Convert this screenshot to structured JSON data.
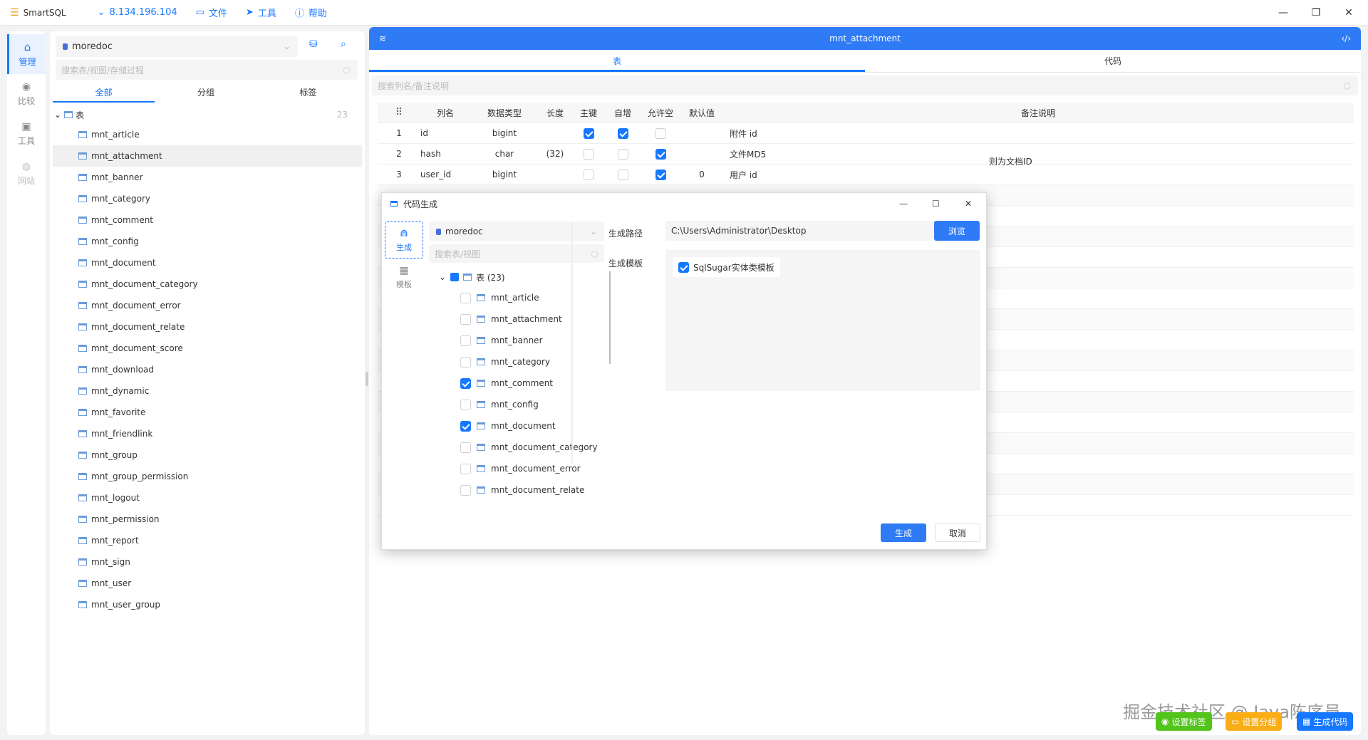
{
  "app": {
    "name": "SmartSQL",
    "server": "8.134.196.104",
    "menu": [
      {
        "label": "文件",
        "icon": "folder-icon"
      },
      {
        "label": "工具",
        "icon": "send-icon"
      },
      {
        "label": "帮助",
        "icon": "info-icon"
      }
    ]
  },
  "nav": [
    {
      "label": "管理",
      "icon": "home-icon",
      "active": true
    },
    {
      "label": "比较",
      "icon": "compare-icon",
      "active": false
    },
    {
      "label": "工具",
      "icon": "tools-icon",
      "active": false
    },
    {
      "label": "网站",
      "icon": "globe-icon",
      "active": false
    }
  ],
  "left": {
    "database": "moredoc",
    "search_placeholder": "搜索表/视图/存储过程",
    "tabs": [
      "全部",
      "分组",
      "标签"
    ],
    "tree_root": "表",
    "tree_count": "23",
    "tables": [
      "mnt_article",
      "mnt_attachment",
      "mnt_banner",
      "mnt_category",
      "mnt_comment",
      "mnt_config",
      "mnt_document",
      "mnt_document_category",
      "mnt_document_error",
      "mnt_document_relate",
      "mnt_document_score",
      "mnt_download",
      "mnt_dynamic",
      "mnt_favorite",
      "mnt_friendlink",
      "mnt_group",
      "mnt_group_permission",
      "mnt_logout",
      "mnt_permission",
      "mnt_report",
      "mnt_sign",
      "mnt_user",
      "mnt_user_group"
    ],
    "selected": "mnt_attachment"
  },
  "right": {
    "title": "mnt_attachment",
    "tabs": [
      "表",
      "代码"
    ],
    "search_placeholder": "搜索列名/备注说明",
    "columns": [
      "列名",
      "数据类型",
      "长度",
      "主键",
      "自增",
      "允许空",
      "默认值",
      "备注说明"
    ],
    "rows": [
      {
        "no": "1",
        "name": "id",
        "type": "bigint",
        "len": "",
        "pk": true,
        "ai": true,
        "null": false,
        "def": "",
        "remark": "附件 id"
      },
      {
        "no": "2",
        "name": "hash",
        "type": "char",
        "len": "(32)",
        "pk": false,
        "ai": false,
        "null": true,
        "def": "",
        "remark": "文件MD5"
      },
      {
        "no": "3",
        "name": "user_id",
        "type": "bigint",
        "len": "",
        "pk": false,
        "ai": false,
        "null": true,
        "def": "0",
        "remark": "用户 id"
      }
    ],
    "partial_remark": "则为文档ID"
  },
  "dialog": {
    "title": "代码生成",
    "side": [
      {
        "label": "生成",
        "icon": "magnet-icon",
        "active": true
      },
      {
        "label": "模板",
        "icon": "gift-icon",
        "active": false
      }
    ],
    "database": "moredoc",
    "search_placeholder": "搜索表/视图",
    "tree_root": "表 (23)",
    "items": [
      {
        "name": "mnt_article",
        "checked": false
      },
      {
        "name": "mnt_attachment",
        "checked": false
      },
      {
        "name": "mnt_banner",
        "checked": false
      },
      {
        "name": "mnt_category",
        "checked": false
      },
      {
        "name": "mnt_comment",
        "checked": true
      },
      {
        "name": "mnt_config",
        "checked": false
      },
      {
        "name": "mnt_document",
        "checked": true
      },
      {
        "name": "mnt_document_category",
        "checked": false
      },
      {
        "name": "mnt_document_error",
        "checked": false
      },
      {
        "name": "mnt_document_relate",
        "checked": false
      }
    ],
    "path_label": "生成路径",
    "path_value": "C:\\Users\\Administrator\\Desktop",
    "browse_label": "浏览",
    "template_label": "生成模板",
    "template_option": "SqlSugar实体类模板",
    "generate_label": "生成",
    "cancel_label": "取消"
  },
  "footer": {
    "watermark": "掘金技术社区 @ Java陈序员",
    "badges": [
      {
        "label": "设置标签",
        "color": "#52c41a"
      },
      {
        "label": "设置分组",
        "color": "#faad14"
      },
      {
        "label": "生成代码",
        "color": "#1677ff"
      }
    ]
  },
  "colors": {
    "accent": "#1677ff",
    "header": "#2f7bf6"
  }
}
